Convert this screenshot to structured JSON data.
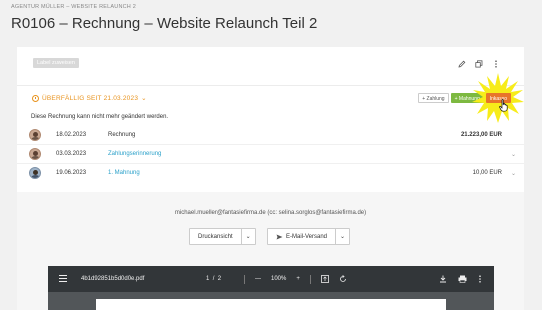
{
  "header": {
    "breadcrumb": "AGENTUR MÜLLER – WEBSITE RELAUNCH 2",
    "title": "R0106 – Rechnung – Website Relaunch Teil 2"
  },
  "card": {
    "label_chip": "Label zuweisen",
    "icons": [
      "pencil-icon",
      "copy-icon",
      "more-vertical-icon"
    ]
  },
  "status": {
    "overdue": "ÜBERFÄLLIG SEIT 21.03.2023",
    "color": "#e8931e"
  },
  "actions": {
    "zahlung": "+ Zahlung",
    "mahnung": "+ Mahnung",
    "inkasso": "Inkasso"
  },
  "note": "Diese Rechnung kann nicht mehr geändert werden.",
  "history": [
    {
      "date": "18.02.2023",
      "type": "Rechnung",
      "amount": "21.223,00 EUR",
      "link": false
    },
    {
      "date": "03.03.2023",
      "type": "Zahlungserinnerung",
      "amount": "",
      "link": true
    },
    {
      "date": "19.06.2023",
      "type": "1. Mahnung",
      "amount": "10,00 EUR",
      "link": true
    }
  ],
  "email": {
    "recipients": "michael.mueller@fantasiefirma.de (cc: selina.sorglos@fantasiefirma.de)",
    "preview_button": "Druckansicht",
    "send_button": "E-Mail-Versand"
  },
  "pdf_viewer": {
    "filename": "4b1d92851b5d0d0e.pdf",
    "page_current": "1",
    "page_sep": "/",
    "page_total": "2",
    "zoom_minus": "—",
    "zoom": "100%",
    "zoom_plus": "+"
  },
  "colors": {
    "accent_link": "#2aa0c9",
    "mahnung": "#7db940",
    "inkasso": "#e8752a",
    "highlight": "#f7ec1a"
  }
}
